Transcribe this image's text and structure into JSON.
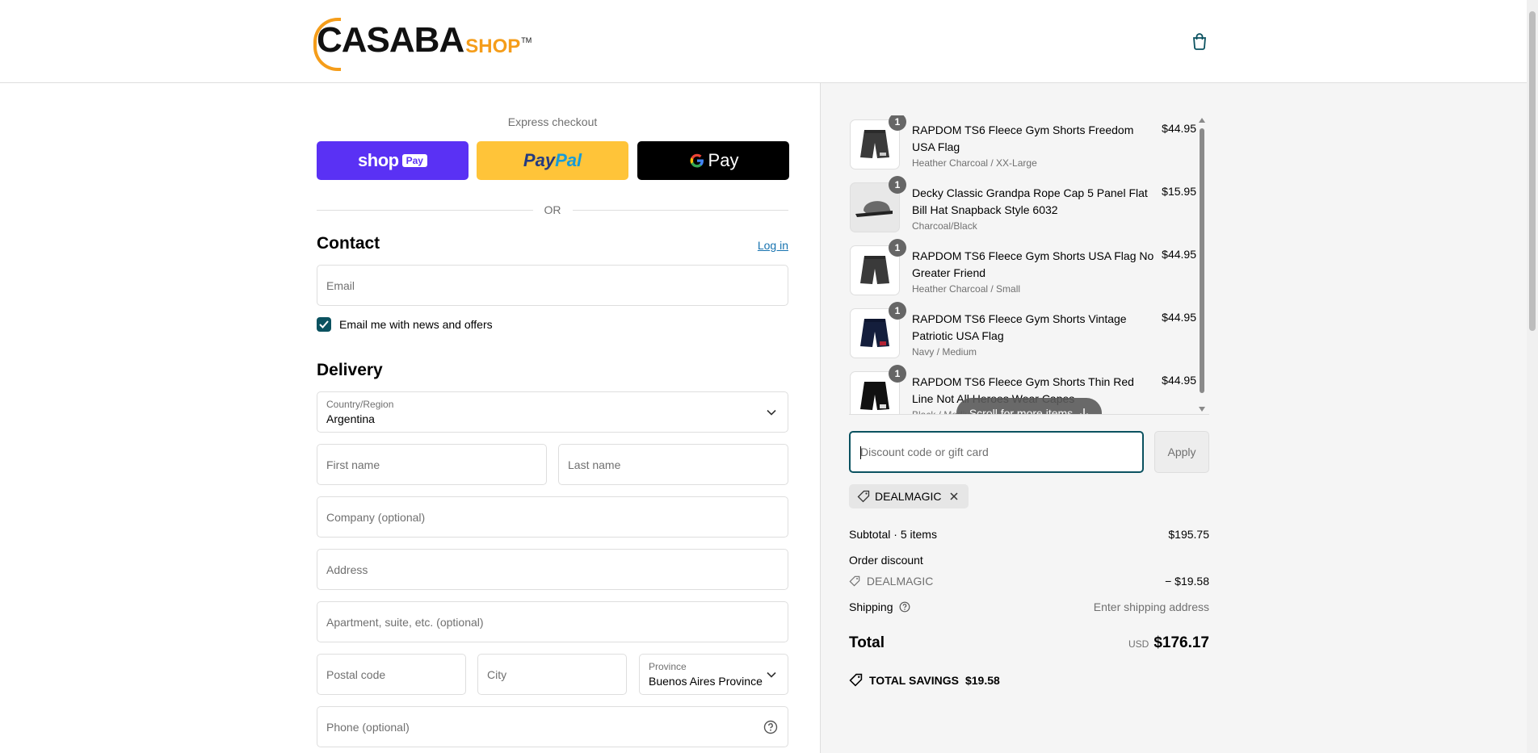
{
  "header": {
    "logo_main": "CASABA",
    "logo_shop": "SHOP",
    "logo_tm": "TM",
    "cart_icon": "shopping-bag-icon"
  },
  "express": {
    "title": "Express checkout",
    "shoppay_label": "shop",
    "shoppay_badge": "Pay",
    "paypal_label_a": "Pay",
    "paypal_label_b": "Pal",
    "gpay_label": "Pay",
    "or_label": "OR"
  },
  "contact": {
    "heading": "Contact",
    "login_label": "Log in",
    "email_placeholder": "Email",
    "newsletter_label": "Email me with news and offers",
    "newsletter_checked": true
  },
  "delivery": {
    "heading": "Delivery",
    "country_label": "Country/Region",
    "country_value": "Argentina",
    "first_name_placeholder": "First name",
    "last_name_placeholder": "Last name",
    "company_placeholder": "Company (optional)",
    "address_placeholder": "Address",
    "apartment_placeholder": "Apartment, suite, etc. (optional)",
    "postal_placeholder": "Postal code",
    "city_placeholder": "City",
    "province_label": "Province",
    "province_value": "Buenos Aires Province",
    "phone_placeholder": "Phone (optional)"
  },
  "cart": {
    "items": [
      {
        "name": "RAPDOM TS6 Fleece Gym Shorts Freedom USA Flag",
        "variant": "Heather Charcoal / XX-Large",
        "price": "$44.95",
        "qty": "1"
      },
      {
        "name": "Decky Classic Grandpa Rope Cap 5 Panel Flat Bill Hat Snapback Style 6032",
        "variant": "Charcoal/Black",
        "price": "$15.95",
        "qty": "1"
      },
      {
        "name": "RAPDOM TS6 Fleece Gym Shorts USA Flag No Greater Friend",
        "variant": "Heather Charcoal / Small",
        "price": "$44.95",
        "qty": "1"
      },
      {
        "name": "RAPDOM TS6 Fleece Gym Shorts Vintage Patriotic USA Flag",
        "variant": "Navy / Medium",
        "price": "$44.95",
        "qty": "1"
      },
      {
        "name": "RAPDOM TS6 Fleece Gym Shorts Thin Red Line Not All Heroes Wear Capes",
        "variant": "Black / Medium",
        "price": "$44.95",
        "qty": "1"
      }
    ],
    "scroll_hint": "Scroll for more items"
  },
  "discount": {
    "placeholder": "Discount code or gift card",
    "apply_label": "Apply",
    "applied_code": "DEALMAGIC"
  },
  "summary": {
    "subtotal_label": "Subtotal · 5 items",
    "subtotal_value": "$195.75",
    "order_discount_label": "Order discount",
    "discount_code": "DEALMAGIC",
    "discount_value": "− $19.58",
    "shipping_label": "Shipping",
    "shipping_value": "Enter shipping address",
    "total_label": "Total",
    "total_currency": "USD",
    "total_value": "$176.17",
    "savings_label": "TOTAL SAVINGS",
    "savings_value": "$19.58"
  },
  "colors": {
    "accent": "#0b5260",
    "shoppay": "#5a31f4",
    "paypal": "#ffc439",
    "link": "#1773b0",
    "logo_orange": "#f59d1a"
  }
}
